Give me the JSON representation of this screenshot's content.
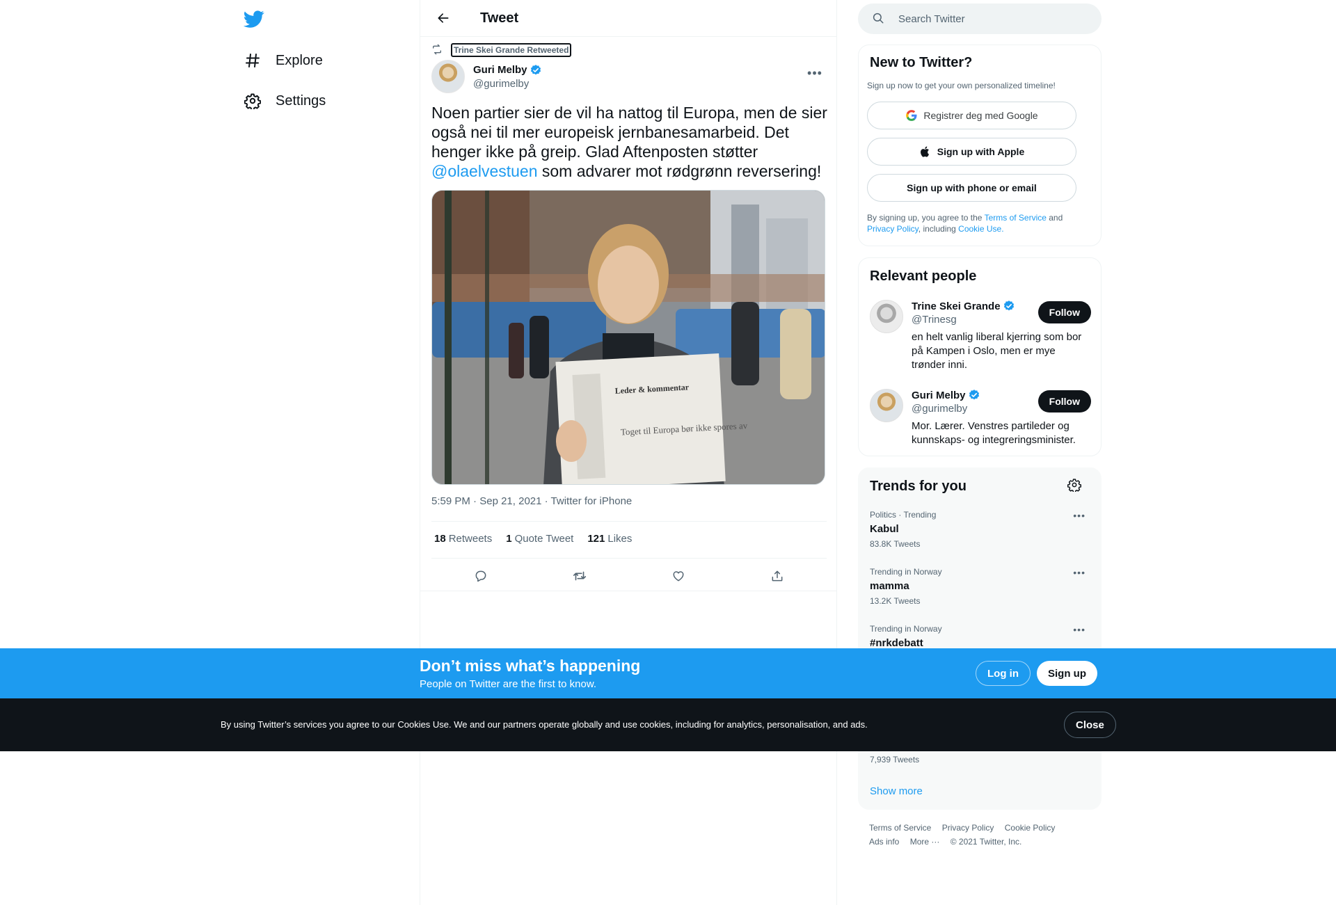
{
  "nav": {
    "items": [
      {
        "label": "Explore",
        "icon": "hashtag-icon"
      },
      {
        "label": "Settings",
        "icon": "gear-icon"
      }
    ]
  },
  "header": {
    "title": "Tweet"
  },
  "tweet": {
    "retweeted_by": "Trine Skei Grande Retweeted",
    "author_name": "Guri Melby",
    "author_handle": "@gurimelby",
    "text_before": "Noen partier sier de vil ha nattog til Europa, men de sier også nei til mer europeisk jernbanesamarbeid. Det henger ikke på greip. Glad Aftenposten støtter ",
    "mention": "@olaelvestuen",
    "text_after": " som advarer mot rødgrønn reversering!",
    "time": "5:59 PM",
    "date": "Sep 21, 2021",
    "source": "Twitter for iPhone",
    "meta_sep": " · ",
    "retweets_count": "18",
    "retweets_label": "Retweets",
    "quotes_count": "1",
    "quotes_label": "Quote Tweet",
    "likes_count": "121",
    "likes_label": "Likes",
    "photo": {
      "newspaper_heading": "Leder & kommentar",
      "headline": "Toget til Europa bør ikke spores av"
    }
  },
  "search": {
    "placeholder": "Search Twitter"
  },
  "new_to_twitter": {
    "title": "New to Twitter?",
    "subtitle": "Sign up now to get your own personalized timeline!",
    "google_label": "Registrer deg med Google",
    "apple_label": "Sign up with Apple",
    "phone_label": "Sign up with phone or email",
    "legal_1": "By signing up, you agree to the ",
    "legal_tos": "Terms of Service",
    "legal_2": " and ",
    "legal_privacy": "Privacy Policy",
    "legal_3": ", including ",
    "legal_cookie": "Cookie Use."
  },
  "relevant_people": {
    "title": "Relevant people",
    "people": [
      {
        "name": "Trine Skei Grande",
        "handle": "@Trinesg",
        "bio": "en helt vanlig liberal kjerring som bor på Kampen i Oslo, men er mye trønder inni.",
        "follow_label": "Follow"
      },
      {
        "name": "Guri Melby",
        "handle": "@gurimelby",
        "bio": "Mor. Lærer. Venstres partileder og kunnskaps- og integreringsminister.",
        "follow_label": "Follow"
      }
    ]
  },
  "trends": {
    "title": "Trends for you",
    "items": [
      {
        "context": "Politics · Trending",
        "name": "Kabul",
        "count": "83.8K Tweets"
      },
      {
        "context": "Trending in Norway",
        "name": "mamma",
        "count": "13.2K Tweets"
      },
      {
        "context": "Trending in Norway",
        "name": "#nrkdebatt",
        "count": ""
      }
    ],
    "late_count": "7,939 Tweets",
    "show_more": "Show more"
  },
  "footer": {
    "links": [
      "Terms of Service",
      "Privacy Policy",
      "Cookie Policy",
      "Ads info",
      "More ···"
    ],
    "copyright": "© 2021 Twitter, Inc."
  },
  "banner": {
    "title": "Don’t miss what’s happening",
    "subtitle": "People on Twitter are the first to know.",
    "login_label": "Log in",
    "signup_label": "Sign up"
  },
  "cookie": {
    "text": "By using Twitter’s services you agree to our Cookies Use. We and our partners operate globally and use cookies, including for analytics, personalisation, and ads.",
    "close_label": "Close"
  },
  "colors": {
    "accent": "#1d9bf0",
    "text": "#0f1419",
    "secondary": "#536471",
    "cookie_bg": "#0f1419"
  }
}
